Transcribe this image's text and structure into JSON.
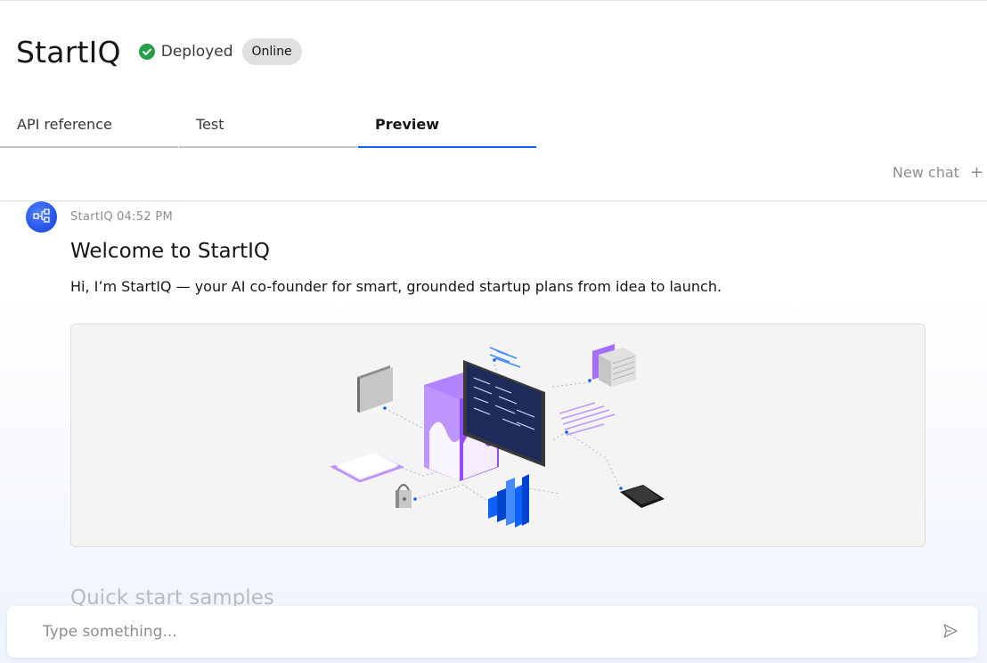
{
  "header": {
    "title": "StartIQ",
    "status_label": "Deployed",
    "badge": "Online",
    "status_color": "#24a148"
  },
  "tabs": [
    {
      "label": "API reference",
      "active": false
    },
    {
      "label": "Test",
      "active": false
    },
    {
      "label": "Preview",
      "active": true
    }
  ],
  "toolbar": {
    "new_chat_label": "New chat",
    "new_chat_icon": "plus-icon"
  },
  "message": {
    "sender": "StartIQ",
    "time": "04:52 PM",
    "title": "Welcome to StartIQ",
    "text": "Hi, I’m StartIQ — your AI co-founder for smart, grounded startup plans from idea to launch.",
    "avatar_icon": "flow-diagram-icon",
    "illustration": "isometric-tech-illustration"
  },
  "samples": {
    "title": "Quick start samples"
  },
  "input": {
    "placeholder": "Type something...",
    "value": "",
    "send_icon": "send-icon"
  },
  "colors": {
    "accent": "#0f62fe",
    "text": "#161616",
    "muted": "#8d8d8d"
  }
}
